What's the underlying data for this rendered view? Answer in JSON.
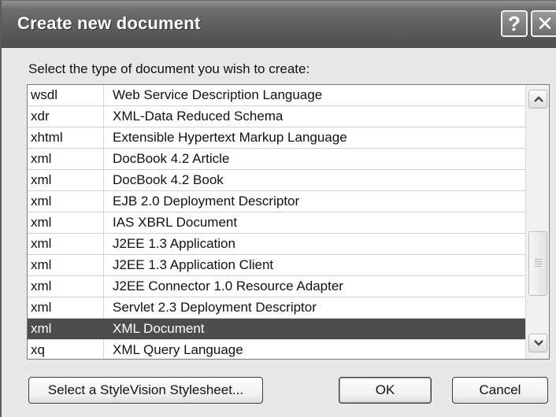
{
  "dialog": {
    "title": "Create new document",
    "help_label": "?",
    "close_label": "✕",
    "prompt": "Select the type of document you wish to create:"
  },
  "document_types": [
    {
      "ext": "wsdl",
      "description": "Web Service Description Language"
    },
    {
      "ext": "xdr",
      "description": "XML-Data Reduced Schema"
    },
    {
      "ext": "xhtml",
      "description": "Extensible Hypertext Markup Language"
    },
    {
      "ext": "xml",
      "description": "DocBook 4.2 Article"
    },
    {
      "ext": "xml",
      "description": "DocBook 4.2 Book"
    },
    {
      "ext": "xml",
      "description": "EJB 2.0 Deployment Descriptor"
    },
    {
      "ext": "xml",
      "description": "IAS XBRL Document"
    },
    {
      "ext": "xml",
      "description": "J2EE 1.3 Application"
    },
    {
      "ext": "xml",
      "description": "J2EE 1.3 Application Client"
    },
    {
      "ext": "xml",
      "description": "J2EE Connector 1.0 Resource Adapter"
    },
    {
      "ext": "xml",
      "description": "Servlet 2.3 Deployment Descriptor"
    },
    {
      "ext": "xml",
      "description": "XML Document",
      "selected": true
    },
    {
      "ext": "xq",
      "description": "XML Query Language"
    }
  ],
  "buttons": {
    "stylesheet_label": "Select a StyleVision Stylesheet...",
    "ok_label": "OK",
    "cancel_label": "Cancel"
  },
  "icons": {
    "help": "help-icon",
    "close": "close-icon",
    "scroll_up": "chevron-up-icon",
    "scroll_down": "chevron-down-icon"
  },
  "colors": {
    "titlebar": "#5d5d5d",
    "selection": "#4d4d4d",
    "dialog_background": "#e8e8e8"
  }
}
